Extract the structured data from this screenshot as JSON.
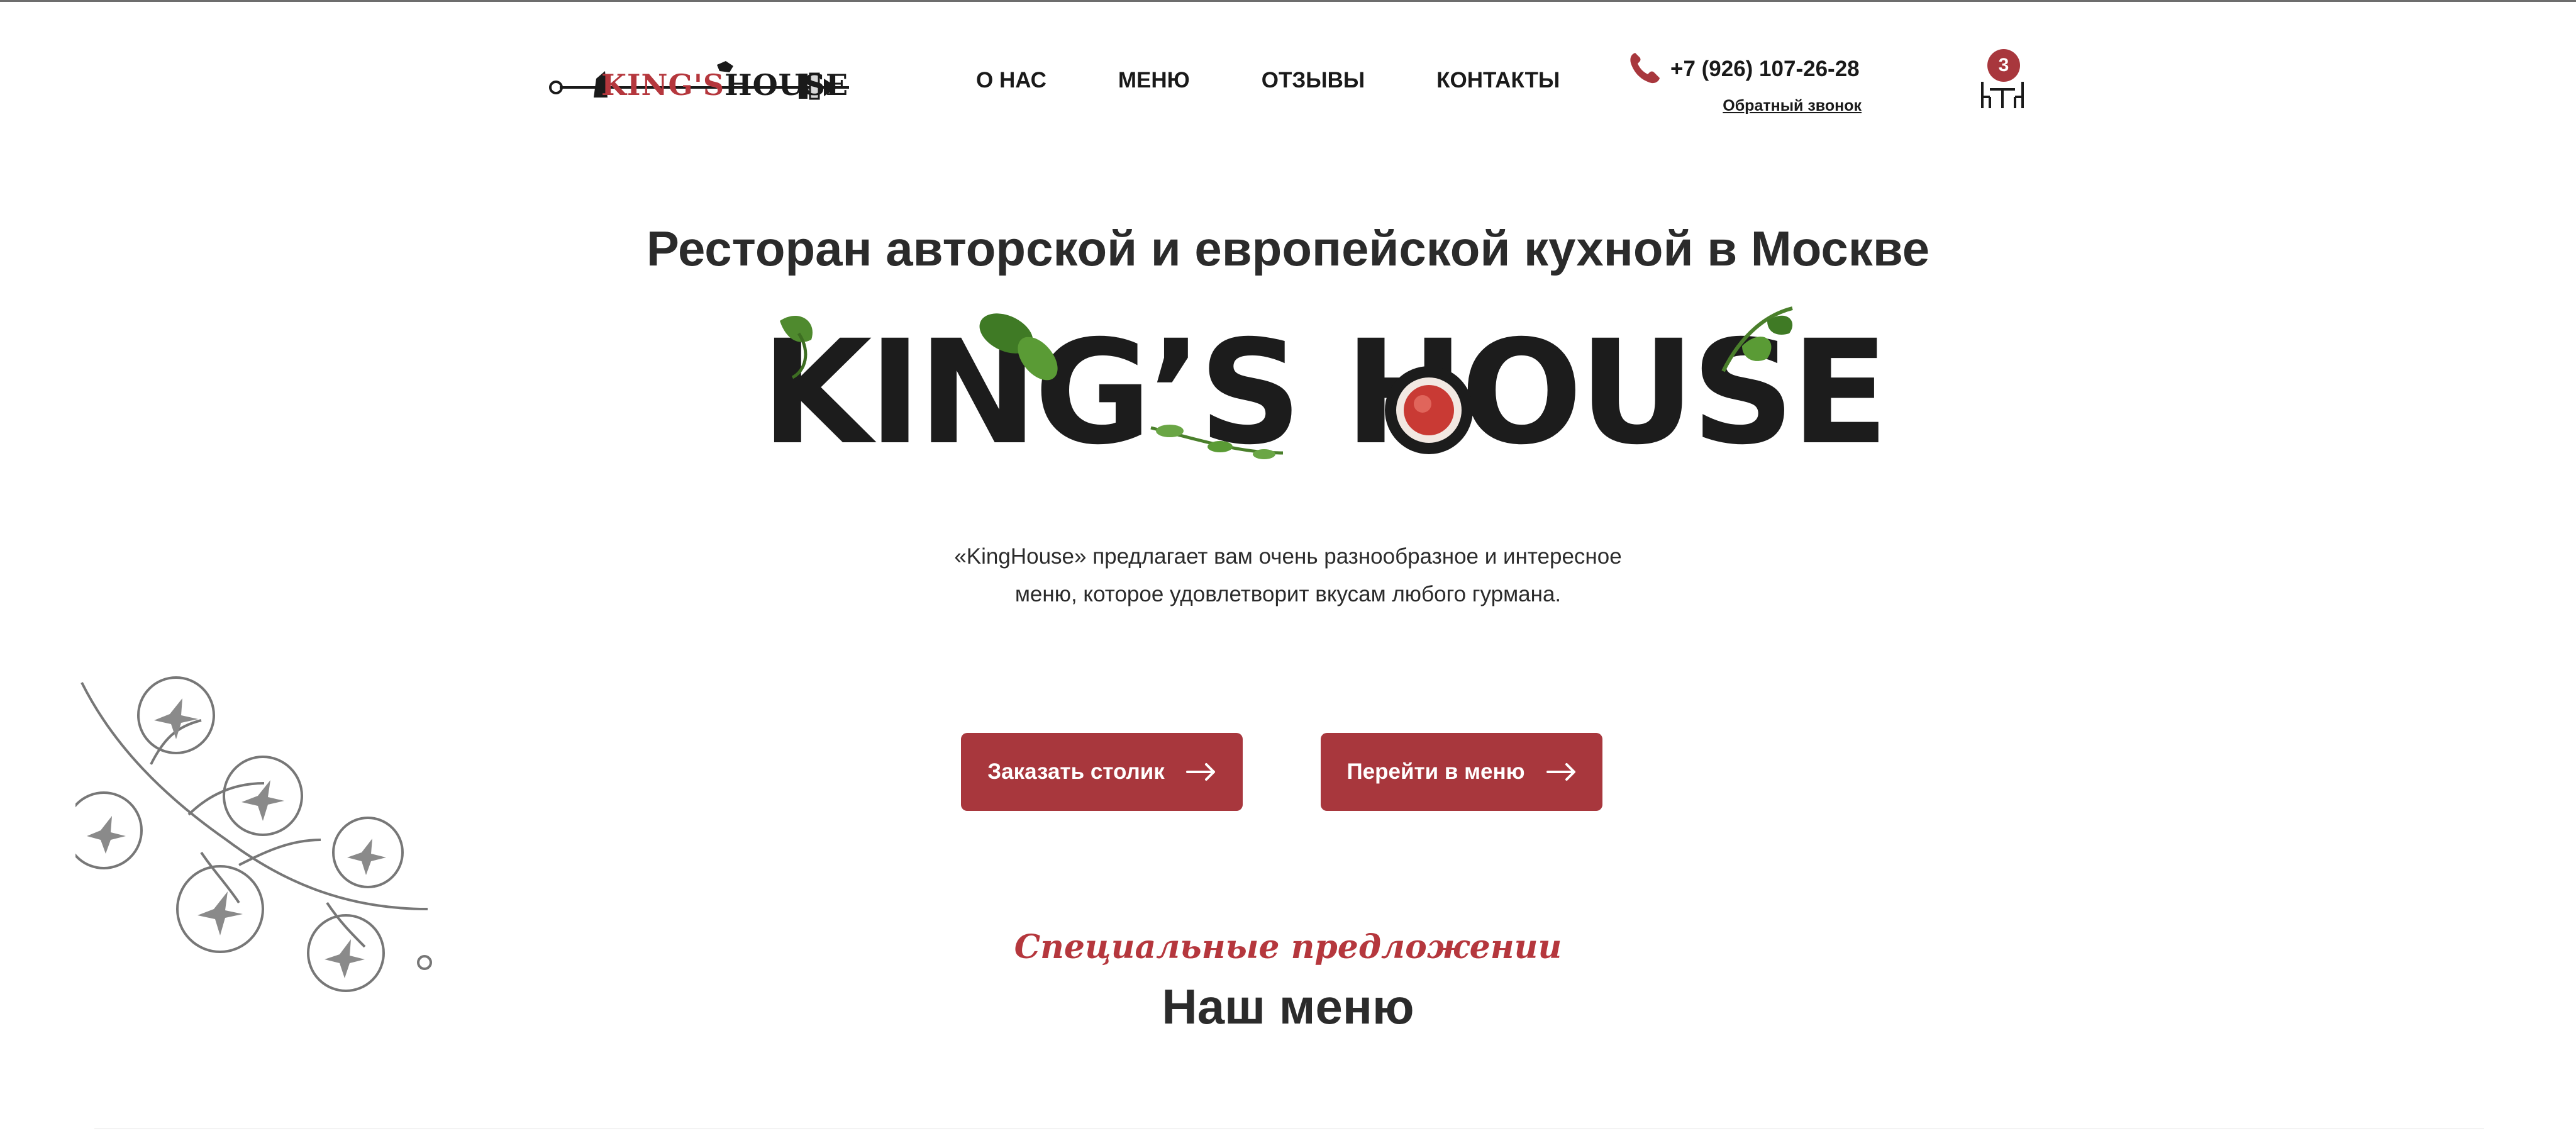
{
  "header": {
    "logo": {
      "text_accent": "KING'S",
      "text_main": "HOUSE",
      "icon": "skewer-logo-icon"
    },
    "nav": [
      {
        "label": "О НАС"
      },
      {
        "label": "МЕНЮ"
      },
      {
        "label": "ОТЗЫВЫ"
      },
      {
        "label": "КОНТАКТЫ"
      }
    ],
    "phone": {
      "icon": "phone-icon",
      "number": "+7 (926) 107-26-28",
      "callback_label": "Обратный звонок"
    },
    "table_cart": {
      "icon": "table-chairs-icon",
      "count": "3"
    }
  },
  "hero": {
    "title": "Ресторан авторской и европейской кухной в Москве",
    "brand_word": "KING’S HOUSE",
    "description": "«KingHouse» предлагает вам очень разнообразное и интересное меню, которое удовлетворит вкусам любого гурмана.",
    "buttons": {
      "book_table": "Заказать столик",
      "go_to_menu": "Перейти в меню"
    }
  },
  "menu_section": {
    "kicker": "Специальные предложении",
    "title": "Наш меню"
  },
  "colors": {
    "accent": "#a8373d",
    "text": "#2b2b2b",
    "background": "#ffffff"
  }
}
